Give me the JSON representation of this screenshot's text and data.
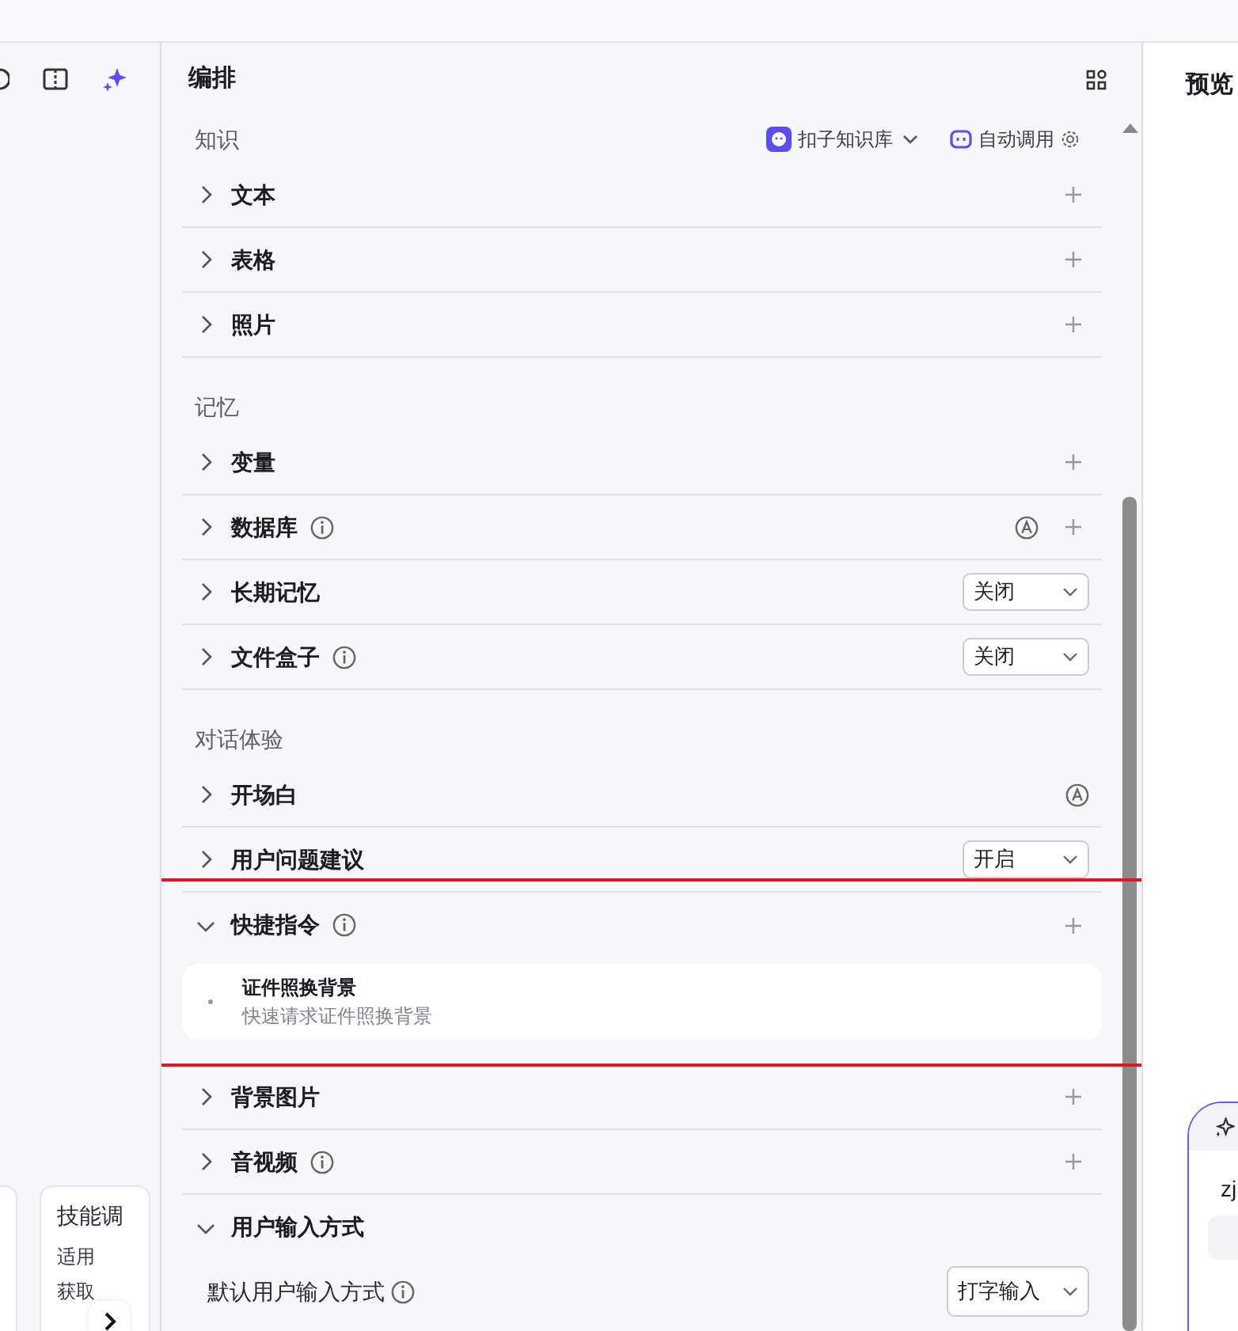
{
  "left_panel": {
    "card": {
      "title": "技能调",
      "lines": [
        "适用",
        "获取"
      ]
    }
  },
  "arrangement": {
    "title": "编排",
    "sections": [
      {
        "title": "知识",
        "knowledge_base": "扣子知识库",
        "call_mode": "自动调用",
        "rows": [
          {
            "label": "文本",
            "expanded": false,
            "info": false,
            "auto": false,
            "add": true
          },
          {
            "label": "表格",
            "expanded": false,
            "info": false,
            "auto": false,
            "add": true
          },
          {
            "label": "照片",
            "expanded": false,
            "info": false,
            "auto": false,
            "add": true
          }
        ]
      },
      {
        "title": "记忆",
        "rows": [
          {
            "label": "变量",
            "expanded": false,
            "info": false,
            "auto": false,
            "add": true
          },
          {
            "label": "数据库",
            "expanded": false,
            "info": true,
            "auto": true,
            "add": true
          },
          {
            "label": "长期记忆",
            "expanded": false,
            "info": false,
            "auto": false,
            "add": false,
            "select": "关闭"
          },
          {
            "label": "文件盒子",
            "expanded": false,
            "info": true,
            "auto": false,
            "add": false,
            "select": "关闭"
          }
        ]
      },
      {
        "title": "对话体验",
        "rows": [
          {
            "label": "开场白",
            "expanded": false,
            "info": false,
            "auto": true,
            "add": false
          },
          {
            "label": "用户问题建议",
            "expanded": false,
            "info": false,
            "auto": false,
            "add": false,
            "select": "开启"
          },
          {
            "label": "快捷指令",
            "expanded": true,
            "info": true,
            "auto": false,
            "add": true,
            "highlighted": true,
            "commands": [
              {
                "title": "证件照换背景",
                "description": "快速请求证件照换背景"
              }
            ]
          },
          {
            "label": "背景图片",
            "expanded": false,
            "info": false,
            "auto": false,
            "add": true
          },
          {
            "label": "音视频",
            "expanded": false,
            "info": true,
            "auto": false,
            "add": true
          },
          {
            "label": "用户输入方式",
            "expanded": true,
            "info": false,
            "auto": false,
            "add": false,
            "settings": [
              {
                "label": "默认用户输入方式",
                "info": true,
                "select": "打字输入"
              }
            ]
          }
        ]
      }
    ]
  },
  "preview": {
    "title": "预览",
    "chat_text": "zj"
  }
}
